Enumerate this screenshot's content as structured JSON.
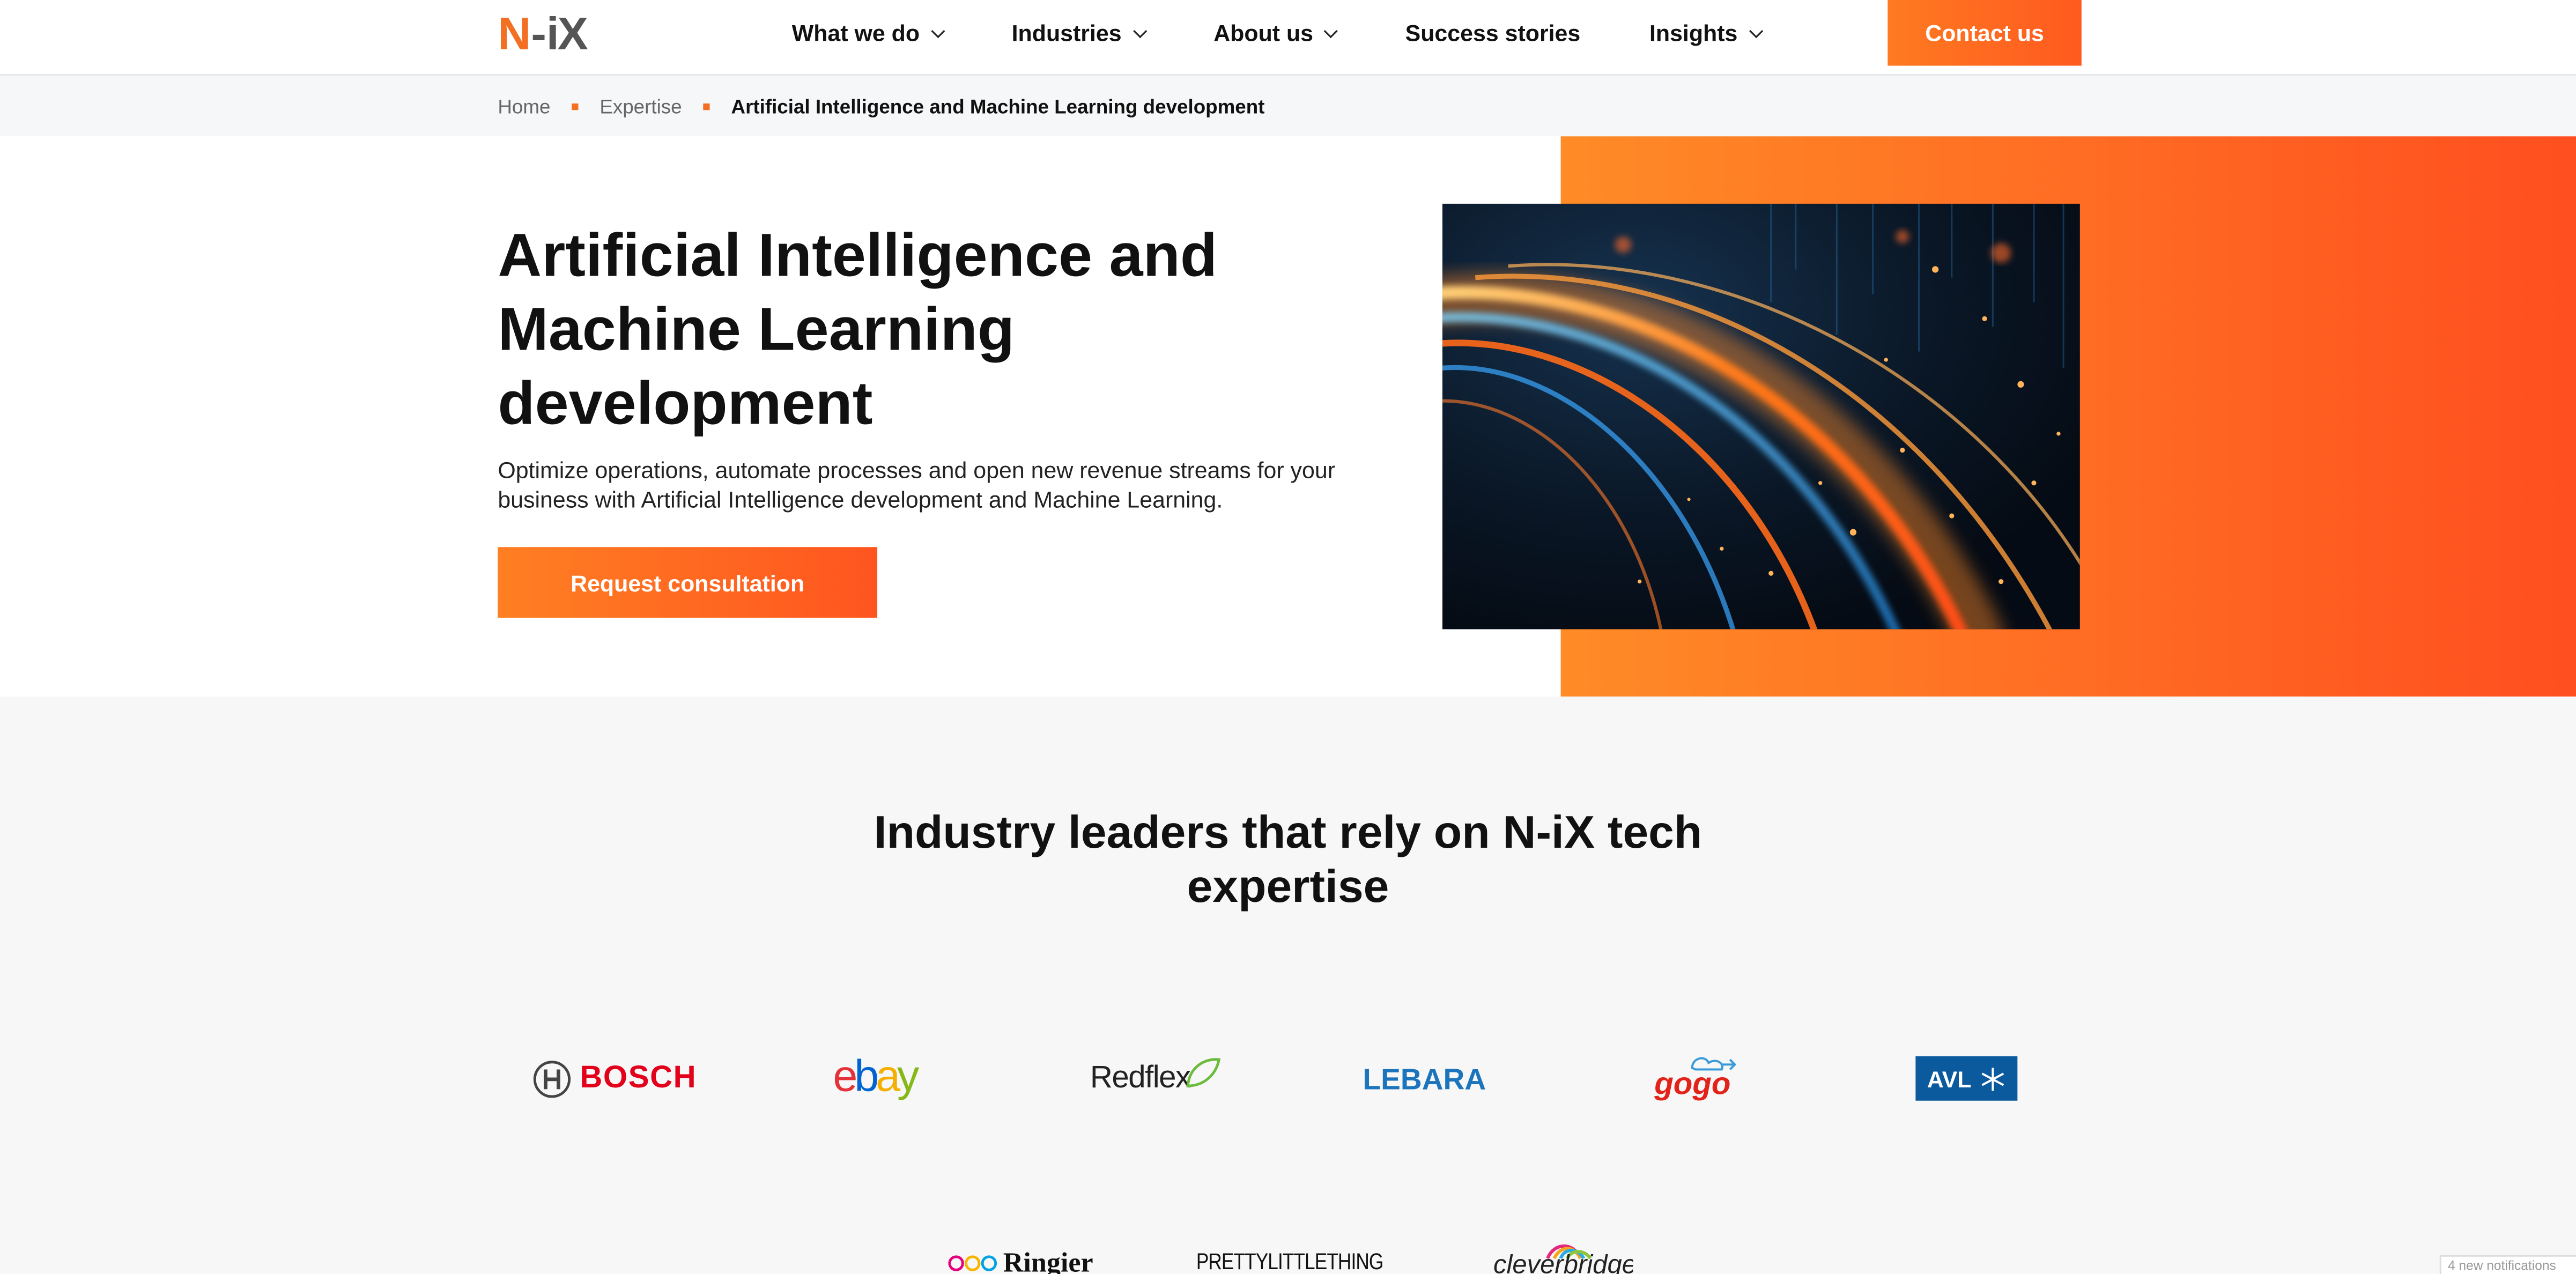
{
  "header": {
    "logo": {
      "n": "N",
      "dash": "-",
      "ix": "iX"
    },
    "nav": [
      {
        "label": "What we do",
        "has_dropdown": true
      },
      {
        "label": "Industries",
        "has_dropdown": true
      },
      {
        "label": "About us",
        "has_dropdown": true
      },
      {
        "label": "Success stories",
        "has_dropdown": false
      },
      {
        "label": "Insights",
        "has_dropdown": true
      }
    ],
    "contact_label": "Contact us"
  },
  "breadcrumb": {
    "items": [
      "Home",
      "Expertise",
      "Artificial Intelligence and Machine Learning development"
    ]
  },
  "hero": {
    "title_lines": [
      "Artificial Intelligence and",
      "Machine Learning",
      "development"
    ],
    "description": "Optimize operations, automate processes and open new revenue streams for your business with Artificial Intelligence development and Machine Learning.",
    "cta_label": "Request consultation"
  },
  "clients": {
    "title_lines": [
      "Industry leaders that rely on N-iX tech",
      "expertise"
    ],
    "logos": {
      "bosch": "BOSCH",
      "ebay": "ebay",
      "redflex": "Redflex",
      "lebara": "LEBARA",
      "gogo": "gogo",
      "avl": "AVL",
      "ringier": "Ringier",
      "plt": "PRETTYLITTLETHING",
      "cleverbridge": "cleverbridge"
    }
  },
  "notification": "4 new notifications",
  "colors": {
    "brand_orange": "#f36f21",
    "orange_light": "#ff8b26",
    "orange_dark": "#ff4e1f",
    "bosch_red": "#e2001a",
    "lebara_blue": "#1c75bc",
    "avl_blue": "#0b5a9e"
  }
}
